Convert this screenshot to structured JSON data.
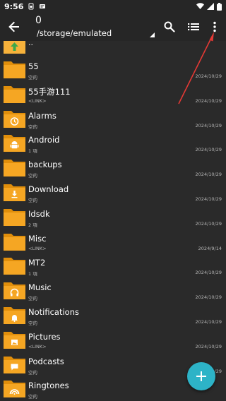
{
  "status_bar": {
    "time": "9:56"
  },
  "toolbar": {
    "title": "0",
    "path": "/storage/emulated"
  },
  "up_item": {
    "label": ".."
  },
  "items": [
    {
      "name": "55",
      "sub": "空的",
      "date": "2024/10/29",
      "icon": "folder-icon"
    },
    {
      "name": "55手游111",
      "sub": "<LINK>",
      "date": "2024/10/29",
      "icon": "folder-icon"
    },
    {
      "name": "Alarms",
      "sub": "空的",
      "date": "2024/10/29",
      "icon": "alarm-folder-icon"
    },
    {
      "name": "Android",
      "sub": "1 項",
      "date": "2024/10/29",
      "icon": "android-folder-icon"
    },
    {
      "name": "backups",
      "sub": "空的",
      "date": "2024/10/29",
      "icon": "folder-icon"
    },
    {
      "name": "Download",
      "sub": "空的",
      "date": "2024/10/29",
      "icon": "download-folder-icon"
    },
    {
      "name": "Idsdk",
      "sub": "2 項",
      "date": "2024/10/29",
      "icon": "folder-icon"
    },
    {
      "name": "Misc",
      "sub": "<LINK>",
      "date": "2024/9/14",
      "icon": "folder-icon"
    },
    {
      "name": "MT2",
      "sub": "1 項",
      "date": "2024/10/29",
      "icon": "folder-icon"
    },
    {
      "name": "Music",
      "sub": "空的",
      "date": "2024/10/29",
      "icon": "music-folder-icon"
    },
    {
      "name": "Notifications",
      "sub": "空的",
      "date": "2024/10/29",
      "icon": "notification-folder-icon"
    },
    {
      "name": "Pictures",
      "sub": "<LINK>",
      "date": "2024/10/29",
      "icon": "pictures-folder-icon"
    },
    {
      "name": "Podcasts",
      "sub": "空的",
      "date": "2024/10/29",
      "icon": "podcast-folder-icon"
    },
    {
      "name": "Ringtones",
      "sub": "空的",
      "date": "2024/10/29",
      "icon": "ringtone-folder-icon"
    }
  ],
  "colors": {
    "folder": "#f5a623",
    "folder_dark": "#e08e0b",
    "fab": "#2db3c7",
    "annotation": "#e53935"
  }
}
